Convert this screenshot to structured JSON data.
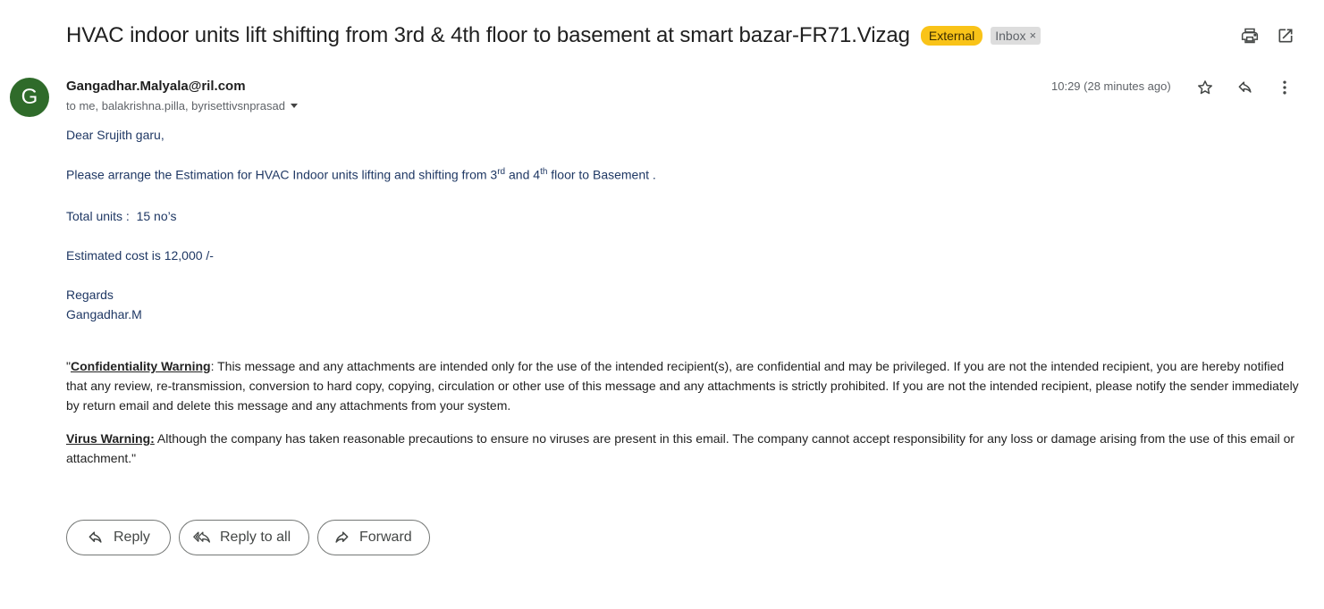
{
  "email": {
    "subject": "HVAC indoor units lift shifting from 3rd & 4th floor to basement at smart bazar-FR71.Vizag",
    "labels": {
      "external": "External",
      "inbox": "Inbox",
      "remove": "×"
    },
    "avatar_letter": "G",
    "sender": "Gangadhar.Malyala@ril.com",
    "recipients": "to me, balakrishna.pilla, byrisettivsnprasad",
    "timestamp": "10:29 (28 minutes ago)",
    "body": {
      "greeting": "Dear Srujith garu,",
      "request_1": "Please arrange the Estimation for HVAC Indoor units lifting and shifting from 3",
      "sup_rd": "rd",
      "request_2": " and 4",
      "sup_th": "th",
      "request_3": " floor to Basement .",
      "units": "Total units :  15 no’s",
      "cost": "Estimated cost is 12,000 /-",
      "regards": "Regards",
      "signature": "Gangadhar.M"
    },
    "disclaimer": {
      "quote_open": "\"",
      "conf_title": "Confidentiality Warning",
      "conf_text": ": This message and any attachments are intended only for the use of the intended recipient(s), are confidential and may be privileged. If you are not the intended recipient, you are hereby notified that any review, re-transmission, conversion to hard copy, copying, circulation or other use of this message and any attachments is strictly prohibited. If you are not the intended recipient, please notify the sender immediately by return email and delete this message and any attachments from your system.",
      "virus_title": "Virus Warning:",
      "virus_text": " Although the company has taken reasonable precautions to ensure no viruses are present in this email. The company cannot accept responsibility for any loss or damage arising from the use of this email or attachment.\""
    },
    "actions": {
      "reply": "Reply",
      "reply_all": "Reply to all",
      "forward": "Forward"
    }
  },
  "icons": [
    "print-icon",
    "open-new-window-icon",
    "star-icon",
    "reply-icon",
    "more-vert-icon",
    "reply-all-icon",
    "forward-icon"
  ],
  "colors": {
    "external_label": "#f9c318",
    "inbox_label": "#dddddd",
    "avatar": "#2f6b2a",
    "body_text": "#1f3864"
  }
}
